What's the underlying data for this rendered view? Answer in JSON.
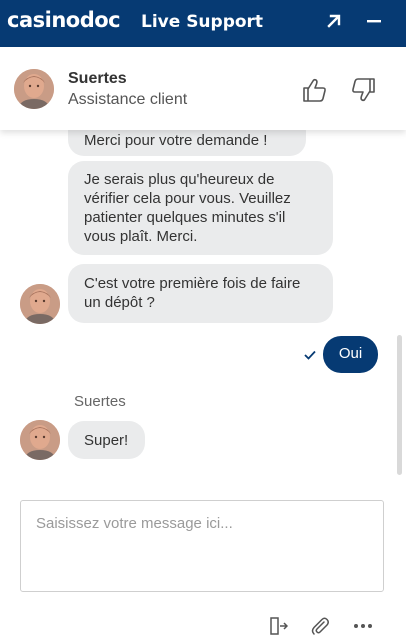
{
  "topbar": {
    "logo_text": "casinodoc",
    "title": "Live Support",
    "popout_icon": "arrow-up-right-icon",
    "minimize_icon": "minus-icon",
    "background_color": "#063a73"
  },
  "agent": {
    "name": "Suertes",
    "role": "Assistance client",
    "thumbs_up_icon": "thumbs-up-icon",
    "thumbs_down_icon": "thumbs-down-icon"
  },
  "messages": [
    {
      "from": "agent",
      "text": "Merci pour votre demande !"
    },
    {
      "from": "agent",
      "text": "Je serais plus qu'heureux de vérifier cela pour vous. Veuillez patienter quelques minutes s'il vous plaît. Merci."
    },
    {
      "from": "agent",
      "text": "C'est votre première fois de faire un dépôt ?"
    },
    {
      "from": "user",
      "text": "Oui",
      "status_icon": "checkmark-icon"
    },
    {
      "from": "agent",
      "sender": "Suertes",
      "text": "Super!"
    }
  ],
  "composer": {
    "placeholder": "Saisissez votre message ici...",
    "value": ""
  },
  "footer": {
    "exit_icon": "exit-door-icon",
    "attach_icon": "paperclip-icon",
    "more_icon": "more-dots-icon"
  },
  "colors": {
    "brand": "#063a73",
    "agent_bubble": "#eaebec",
    "user_bubble": "#063a73"
  }
}
